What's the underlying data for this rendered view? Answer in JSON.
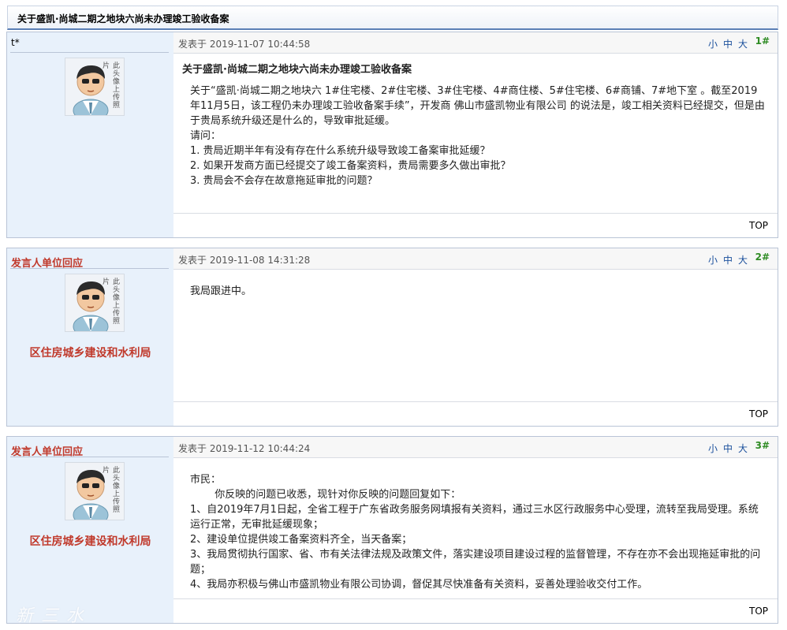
{
  "thread": {
    "title": "关于盛凯·尚城二期之地块六尚未办理竣工验收备案"
  },
  "ui": {
    "font_small": "小",
    "font_medium": "中",
    "font_large": "大",
    "top_label": "TOP",
    "avatar_caption": "此头像上传照片"
  },
  "colors": {
    "accent": "#5a7fb5",
    "sidebar_bg": "#e8f1fb",
    "reply_red": "#c0392b",
    "floor_green": "#2e8b23"
  },
  "posts": [
    {
      "author": "t*",
      "posted_at": "发表于 2019-11-07 10:44:58",
      "floor": "1#",
      "heading": "关于盛凯·尚城二期之地块六尚未办理竣工验收备案",
      "lines": [
        "关于“盛凯·尚城二期之地块六 1#住宅楼、2#住宅楼、3#住宅楼、4#商住楼、5#住宅楼、6#商铺、7#地下室 。截至2019年11月5日，该工程仍未办理竣工验收备案手续”，开发商 佛山市盛凯物业有限公司 的说法是，竣工相关资料已经提交，但是由于贵局系统升级还是什么的，导致审批延缓。",
        "请问：",
        "1. 贵局近期半年有没有存在什么系统升级导致竣工备案审批延缓？",
        "2. 如果开发商方面已经提交了竣工备案资料，贵局需要多久做出审批？",
        "3. 贵局会不会存在故意拖延审批的问题？"
      ]
    },
    {
      "author": "发言人单位回应",
      "unit": "区住房城乡建设和水利局",
      "posted_at": "发表于 2019-11-08 14:31:28",
      "floor": "2#",
      "lines": [
        "我局跟进中。"
      ]
    },
    {
      "author": "发言人单位回应",
      "unit": "区住房城乡建设和水利局",
      "posted_at": "发表于 2019-11-12 10:44:24",
      "floor": "3#",
      "lines": [
        "市民：",
        "你反映的问题已收悉，现针对你反映的问题回复如下：",
        "1、自2019年7月1日起，全省工程于广东省政务服务网填报有关资料，通过三水区行政服务中心受理，流转至我局受理。系统运行正常，无审批延缓现象；",
        "2、建设单位提供竣工备案资料齐全，当天备案；",
        "3、我局贯彻执行国家、省、市有关法律法规及政策文件，落实建设项目建设过程的监督管理，不存在亦不会出现拖延审批的问题；",
        "4、我局亦积极与佛山市盛凯物业有限公司协调，督促其尽快准备有关资料，妥善处理验收交付工作。"
      ]
    }
  ],
  "watermark": "新三水"
}
